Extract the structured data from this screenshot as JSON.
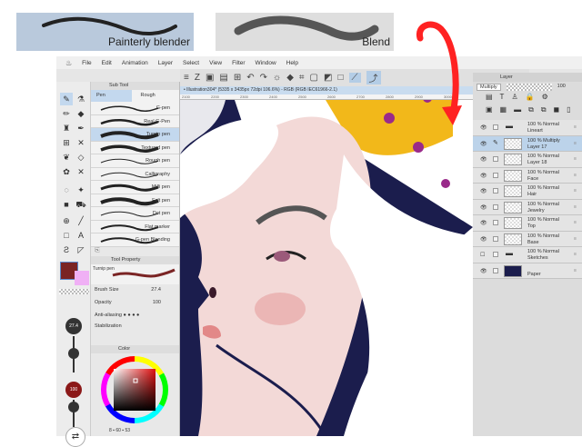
{
  "thumbnails": [
    {
      "label": "Painterly blender",
      "bg": "#b9c9dc"
    },
    {
      "label": "Blend",
      "bg": "#dedede"
    }
  ],
  "menu": [
    "File",
    "Edit",
    "Animation",
    "Layer",
    "Select",
    "View",
    "Filter",
    "Window",
    "Help"
  ],
  "document_title": "• Illustration304* (5335 x 3435px 72dpi 106.6%) - RGB (RGB IEC61966-2.1)",
  "ruler_ticks": [
    "2100",
    "2200",
    "2300",
    "2400",
    "2500",
    "2600",
    "2700",
    "2800",
    "2900",
    "3000"
  ],
  "subtool": {
    "tab": "Sub Tool",
    "groups": [
      "Pen",
      "Rough"
    ],
    "brushes": [
      "G-pen",
      "Real G-Pen",
      "Turnip pen",
      "Textured pen",
      "Rough pen",
      "Calligraphy",
      "Milli pen",
      "Felt pen",
      "Dot pen",
      "Flat marker",
      "G-pen Blending"
    ],
    "selected": 2
  },
  "tool_property": {
    "tab": "Tool Property",
    "brush_name": "Turnip pen",
    "brush_size_label": "Brush Size",
    "brush_size": "27.4",
    "opacity_label": "Opacity",
    "opacity": "100",
    "anti_aliasing_label": "Anti-aliasing",
    "stabilization_label": "Stabilization"
  },
  "color": {
    "tab": "Color",
    "main": "#7a2424",
    "sub": "#f0b0f5",
    "values": [
      "8",
      "60",
      "53"
    ]
  },
  "toolbox": {
    "size_badge": "27.4",
    "opacity_badge": "100"
  },
  "layer_panel": {
    "tab": "Layer",
    "blend_mode": "Multiply",
    "opacity": "100",
    "layers": [
      {
        "line1": "100 % Normal",
        "name": "Lineart",
        "folder": true
      },
      {
        "line1": "100 % Multiply",
        "name": "Layer 17",
        "selected": true
      },
      {
        "line1": "100 % Normal",
        "name": "Layer 18"
      },
      {
        "line1": "100 % Normal",
        "name": "Face"
      },
      {
        "line1": "100 % Normal",
        "name": "Hair"
      },
      {
        "line1": "100 % Normal",
        "name": "Jewelry"
      },
      {
        "line1": "100 % Normal",
        "name": "Top"
      },
      {
        "line1": "100 % Normal",
        "name": "Base"
      },
      {
        "line1": "100 % Normal",
        "name": "Sketches",
        "folder": true
      },
      {
        "line1": "",
        "name": "Paper"
      }
    ]
  }
}
